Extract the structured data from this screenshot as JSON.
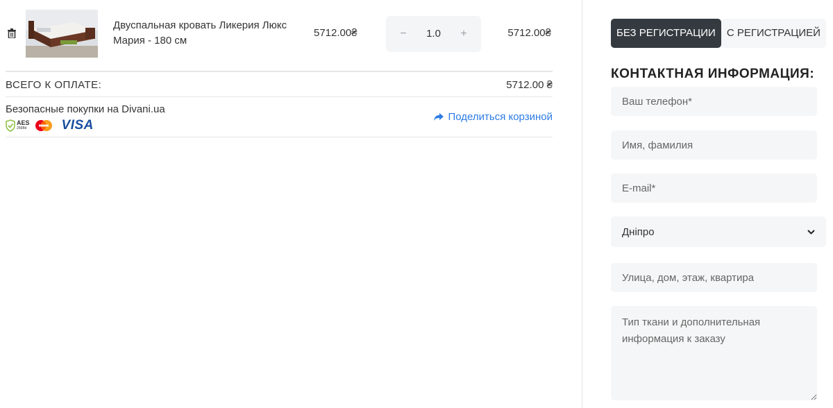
{
  "cart": {
    "item": {
      "name": "Двуспальная кровать Ликерия Люкс Мария - 180 см",
      "unit_price": "5712.00₴",
      "quantity": "1.0",
      "qty_minus": "−",
      "qty_plus": "+",
      "line_total": "5712.00₴"
    },
    "total_label": "ВСЕГО К ОПЛАТЕ:",
    "total_amount": "5712.00 ₴",
    "secure_text": "Безопасные покупки на Divani.ua",
    "badges": {
      "aes_line1": "AES",
      "aes_line2": "256Bit",
      "visa": "VISA"
    },
    "share_label": "Поделиться корзиной"
  },
  "sidebar": {
    "tabs": [
      {
        "label": "БЕЗ РЕГИСТРАЦИИ",
        "active": true
      },
      {
        "label": "С РЕГИСТРАЦИЕЙ",
        "active": false
      }
    ],
    "contact_title": "КОНТАКТНАЯ ИНФОРМАЦИЯ:",
    "fields": {
      "phone_placeholder": "Ваш телефон*",
      "name_placeholder": "Имя, фамилия",
      "email_placeholder": "E-mail*",
      "city_value": "Дніпро",
      "street_placeholder": "Улица, дом, этаж, квартира",
      "notes_placeholder": "Тип ткани и дополнительная информация к заказу"
    }
  },
  "colors": {
    "accent_link": "#2c7be5",
    "tab_active_bg": "#343a40",
    "field_bg": "#f5f6f7"
  },
  "icons": [
    "trash-icon",
    "share-arrow-icon",
    "chevron-down-icon",
    "aes-shield-icon",
    "mastercard-icon",
    "visa-icon"
  ]
}
